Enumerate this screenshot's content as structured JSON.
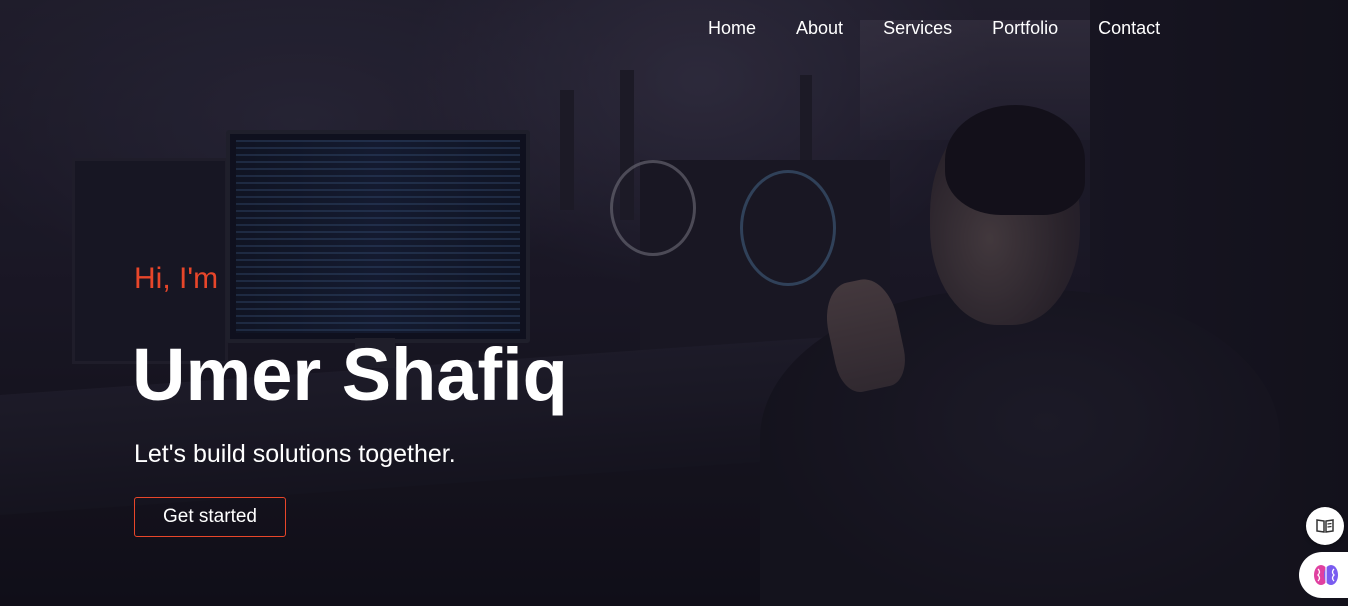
{
  "nav": {
    "items": [
      "Home",
      "About",
      "Services",
      "Portfolio",
      "Contact"
    ]
  },
  "hero": {
    "greeting": "Hi, I'm",
    "name": "Umer Shafiq",
    "tagline": "Let's build solutions together.",
    "cta_label": "Get started"
  },
  "widgets": {
    "reader_icon": "book-icon",
    "brain_icon": "brain-icon"
  },
  "colors": {
    "accent": "#e8462a",
    "text": "#ffffff",
    "background": "#15141f"
  }
}
